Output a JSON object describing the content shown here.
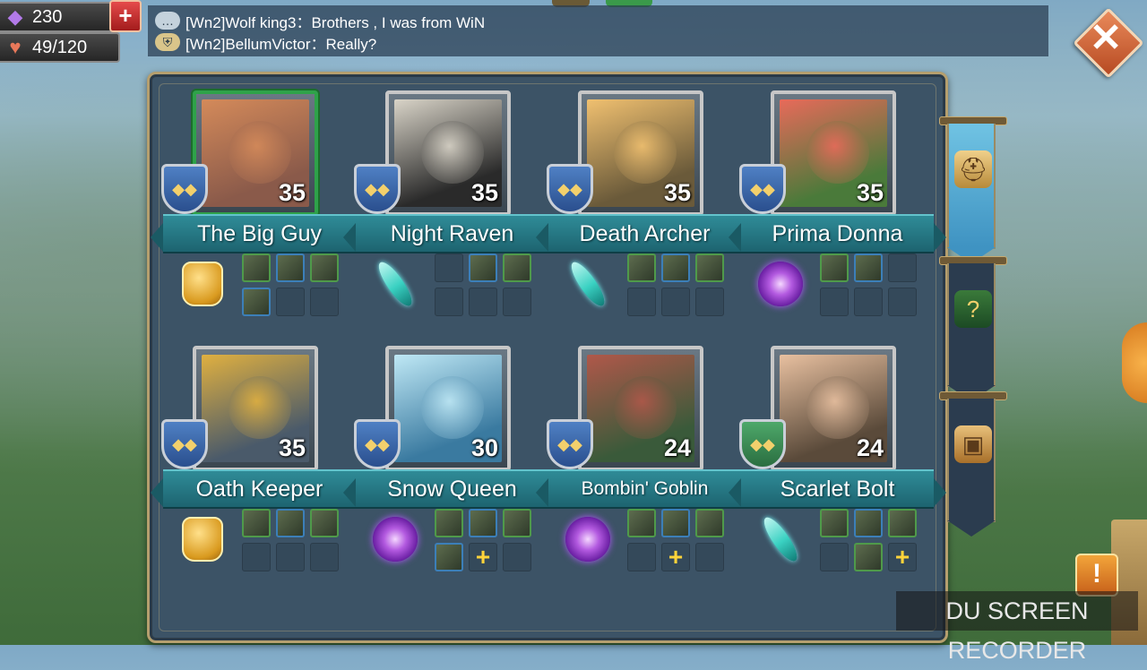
{
  "resources": {
    "gems": "230",
    "stamina": "49/120",
    "add_label": "+"
  },
  "chat": {
    "messages": [
      {
        "author": "[Wn2]Wolf king3",
        "text": "Brothers , I was from WiN",
        "line": "[Wn2]Wolf king3：Brothers , I was from WiN"
      },
      {
        "author": "[Wn2]BellumVictor",
        "text": "Really?",
        "line": "[Wn2]BellumVictor：Really?"
      }
    ]
  },
  "close_label": "✕",
  "heroes": [
    {
      "name": "The Big Guy",
      "level": "35",
      "class_icon": "fist",
      "selected": true,
      "shield": "blue",
      "slots": [
        "gear",
        "gear",
        "gear",
        "gear",
        "empty",
        "empty"
      ],
      "art": [
        "#8a5a4a",
        "#d48a5a"
      ]
    },
    {
      "name": "Night Raven",
      "level": "35",
      "class_icon": "feather",
      "selected": false,
      "shield": "blue",
      "slots": [
        "empty",
        "gear",
        "gear",
        "empty",
        "empty",
        "empty"
      ],
      "art": [
        "#2a2a2a",
        "#d9d4c8"
      ]
    },
    {
      "name": "Death Archer",
      "level": "35",
      "class_icon": "feather",
      "selected": false,
      "shield": "blue",
      "slots": [
        "gear",
        "gear",
        "gear",
        "empty",
        "empty",
        "empty"
      ],
      "art": [
        "#6a5a3a",
        "#f0c070"
      ]
    },
    {
      "name": "Prima Donna",
      "level": "35",
      "class_icon": "orb",
      "selected": false,
      "shield": "blue",
      "slots": [
        "gear",
        "gear",
        "empty",
        "empty",
        "empty",
        "empty"
      ],
      "art": [
        "#4a7a3a",
        "#e86a5a"
      ]
    },
    {
      "name": "Oath Keeper",
      "level": "35",
      "class_icon": "fist",
      "selected": false,
      "shield": "blue",
      "slots": [
        "gear",
        "gear",
        "gear",
        "empty",
        "empty",
        "empty"
      ],
      "art": [
        "#4a5a6a",
        "#e0b040"
      ]
    },
    {
      "name": "Snow Queen",
      "level": "30",
      "class_icon": "orb",
      "selected": false,
      "shield": "blue",
      "slots": [
        "gear",
        "gear",
        "gear",
        "gear",
        "plus",
        "empty"
      ],
      "art": [
        "#3a7aa0",
        "#bfe8f5"
      ]
    },
    {
      "name": "Bombin' Goblin",
      "level": "24",
      "class_icon": "orb",
      "selected": false,
      "shield": "blue",
      "slots": [
        "gear",
        "gear",
        "gear",
        "empty",
        "plus",
        "empty"
      ],
      "art": [
        "#3a5a3a",
        "#b0584a"
      ]
    },
    {
      "name": "Scarlet Bolt",
      "level": "24",
      "class_icon": "feather",
      "selected": false,
      "shield": "green",
      "slots": [
        "gear",
        "gear",
        "gear",
        "empty",
        "gear",
        "plus"
      ],
      "art": [
        "#5a4a3a",
        "#e8c0a0"
      ]
    }
  ],
  "side_tabs": [
    {
      "icon": "helmet-icon",
      "glyph": "⛑",
      "active": true
    },
    {
      "icon": "question-icon",
      "glyph": "?",
      "active": false
    },
    {
      "icon": "chest-icon",
      "glyph": "▣",
      "active": false
    }
  ],
  "alert_label": "!",
  "watermark": "DU SCREEN RECORDER"
}
